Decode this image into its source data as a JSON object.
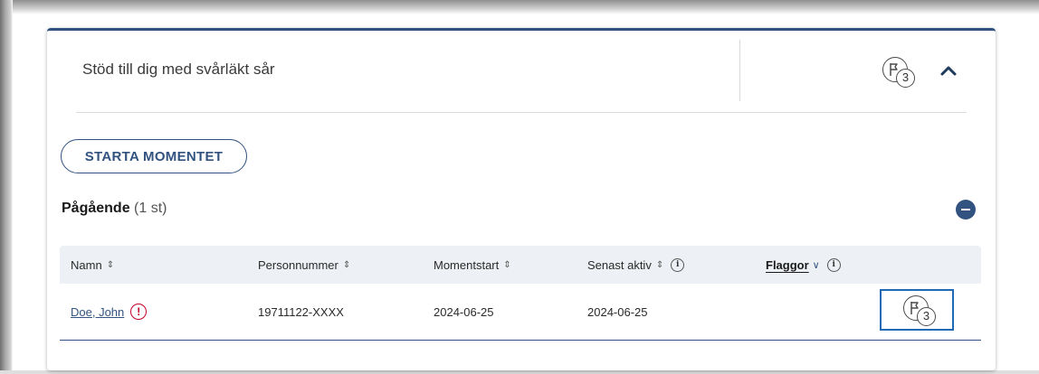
{
  "card": {
    "title": "Stöd till dig med svårläkt sår",
    "flag_count": "3"
  },
  "actions": {
    "start_label": "STARTA MOMENTET"
  },
  "section": {
    "title": "Pågående",
    "count": "(1 st)"
  },
  "table": {
    "columns": {
      "name": "Namn",
      "personnummer": "Personnummer",
      "momentstart": "Momentstart",
      "senast_aktiv": "Senast aktiv",
      "flaggor": "Flaggor"
    },
    "rows": [
      {
        "name": "Doe, John",
        "personnummer": "19711122-XXXX",
        "momentstart": "2024-06-25",
        "senast_aktiv": "2024-06-25",
        "flag_count": "3"
      }
    ]
  },
  "icons": {
    "flag": "flag-icon",
    "collapse": "chevron-up-icon",
    "sort": "sort-icon",
    "info": "info-icon",
    "warning": "exclamation-icon",
    "minus": "minus-circle-icon"
  },
  "colors": {
    "accent": "#32527f",
    "warning": "#c0002b",
    "focus": "#1f6ab3",
    "table_header_bg": "#edf0f4"
  }
}
